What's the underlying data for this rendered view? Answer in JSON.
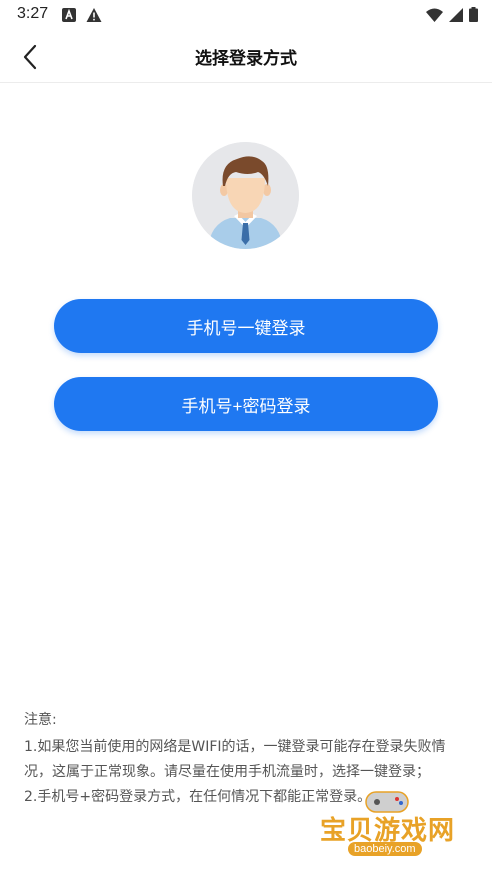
{
  "status_bar": {
    "time": "3:27",
    "icons": [
      "a-notification-icon",
      "warning-icon",
      "wifi-icon",
      "signal-icon",
      "battery-icon"
    ]
  },
  "header": {
    "title": "选择登录方式",
    "back_icon": "back-arrow-icon"
  },
  "avatar": {
    "icon": "user-avatar"
  },
  "buttons": {
    "one_click_login": "手机号一键登录",
    "password_login": "手机号+密码登录"
  },
  "notes": {
    "heading": "注意:",
    "items": [
      " 1.如果您当前使用的网络是WIFI的话，一键登录可能存在登录失败情况，这属于正常现象。请尽量在使用手机流量时，选择一键登录；",
      " 2.手机号+密码登录方式，在任何情况下都能正常登录。"
    ]
  },
  "watermark": {
    "title": "宝贝游戏网",
    "url": "baobeiy.com"
  },
  "colors": {
    "primary": "#1f78f1",
    "watermark": "#e8a227"
  }
}
